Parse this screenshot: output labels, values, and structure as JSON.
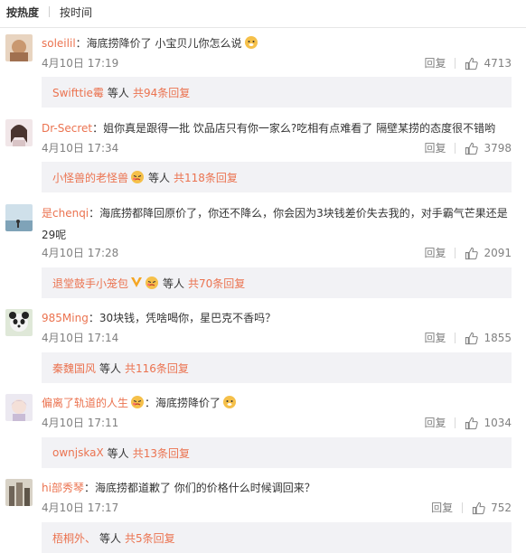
{
  "sort": {
    "hot": "按热度",
    "time": "按时间"
  },
  "comments": [
    {
      "user": "soleilil",
      "sep": "：",
      "text": "海底捞降价了 小宝贝儿你怎么说",
      "time": "4月10日 17:19",
      "reply_label": "回复",
      "likes": "4713",
      "replies": {
        "user": "Swifttie霉",
        "mid": "等人",
        "count": "共94条回复"
      }
    },
    {
      "user": "Dr-Secret",
      "sep": "：",
      "text": "姐你真是跟得一批 饮品店只有你一家么?吃相有点难看了 隔壁某捞的态度很不错哟",
      "time": "4月10日 17:34",
      "reply_label": "回复",
      "likes": "3798",
      "replies": {
        "user": "小怪兽的老怪兽",
        "mid": "等人",
        "count": "共118条回复"
      }
    },
    {
      "user": "是chenqi",
      "sep": "：",
      "text": "海底捞都降回原价了，你还不降么，你会因为3块钱差价失去我的，对手霸气芒果还是29呢",
      "time": "4月10日 17:28",
      "reply_label": "回复",
      "likes": "2091",
      "replies": {
        "user": "退堂鼓手小笼包",
        "mid": "等人",
        "count": "共70条回复"
      }
    },
    {
      "user": "985Ming",
      "sep": "：",
      "text": "30块钱，凭啥喝你，星巴克不香吗？",
      "time": "4月10日 17:14",
      "reply_label": "回复",
      "likes": "1855",
      "replies": {
        "user": "秦魏国风",
        "mid": "等人",
        "count": "共116条回复"
      }
    },
    {
      "user": "偏离了轨道的人生",
      "sep": "：",
      "text": "海底捞降价了",
      "time": "4月10日 17:11",
      "reply_label": "回复",
      "likes": "1034",
      "replies": {
        "user": "ownjskaX",
        "mid": "等人",
        "count": "共13条回复"
      }
    },
    {
      "user": "hi部秀琴",
      "sep": "：",
      "text": "海底捞都道歉了 你们的价格什么时候调回来？",
      "time": "4月10日 17:17",
      "reply_label": "回复",
      "likes": "752",
      "replies": {
        "user": "梧桐外、",
        "mid": "等人",
        "count": "共5条回复"
      }
    }
  ],
  "colors": {
    "username": "#eb7350",
    "meta": "#808080",
    "reply_bg": "#f2f2f5"
  }
}
